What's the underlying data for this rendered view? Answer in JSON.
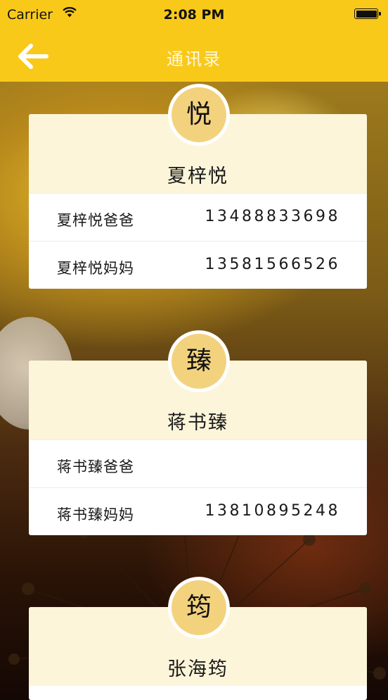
{
  "status_bar": {
    "carrier": "Carrier",
    "time": "2:08 PM"
  },
  "nav": {
    "title": "通讯录",
    "back_icon": "arrow-left-icon"
  },
  "colors": {
    "accent": "#f9c91a",
    "card_header": "#fdf5da",
    "avatar_bg": "#f3d27e"
  },
  "contacts": [
    {
      "avatar_char": "悦",
      "name": "夏梓悦",
      "entries": [
        {
          "label": "夏梓悦爸爸",
          "phone": "13488833698"
        },
        {
          "label": "夏梓悦妈妈",
          "phone": "13581566526"
        }
      ]
    },
    {
      "avatar_char": "臻",
      "name": "蒋书臻",
      "entries": [
        {
          "label": "蒋书臻爸爸",
          "phone": ""
        },
        {
          "label": "蒋书臻妈妈",
          "phone": "13810895248"
        }
      ]
    },
    {
      "avatar_char": "筠",
      "name": "张海筠",
      "entries": []
    }
  ]
}
